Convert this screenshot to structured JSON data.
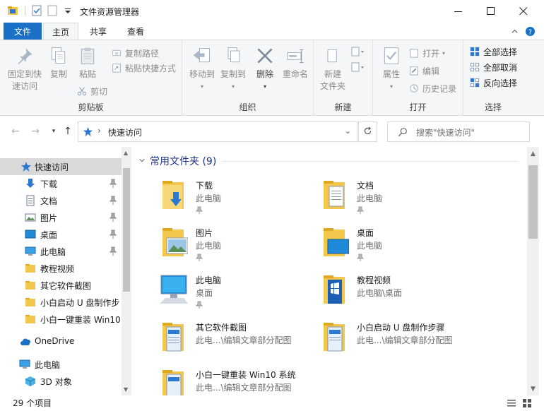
{
  "window": {
    "title": "文件资源管理器"
  },
  "tabs": {
    "file": "文件",
    "items": [
      "主页",
      "共享",
      "查看"
    ]
  },
  "ribbon": {
    "clipboard": {
      "pin_label_1": "固定到快",
      "pin_label_2": "速访问",
      "copy": "复制",
      "paste": "粘贴",
      "copy_path": "复制路径",
      "paste_shortcut": "粘贴快捷方式",
      "cut": "剪切",
      "group_label": "剪贴板"
    },
    "organize": {
      "move_to": "移动到",
      "copy_to": "复制到",
      "delete": "删除",
      "rename": "重命名",
      "group_label": "组织"
    },
    "new": {
      "new_folder_1": "新建",
      "new_folder_2": "文件夹",
      "group_label": "新建"
    },
    "open": {
      "properties": "属性",
      "open": "打开",
      "edit": "编辑",
      "history": "历史记录",
      "group_label": "打开"
    },
    "select": {
      "select_all": "全部选择",
      "select_none": "全部取消",
      "invert": "反向选择",
      "group_label": "选择"
    }
  },
  "address": {
    "path": "快速访问",
    "search_placeholder": "搜索\"快速访问\""
  },
  "nav": {
    "items": [
      {
        "label": "快速访问",
        "icon": "quick-access-star-icon",
        "pinned": false
      },
      {
        "label": "下载",
        "icon": "download-arrow-icon",
        "pinned": true
      },
      {
        "label": "文档",
        "icon": "document-icon",
        "pinned": true
      },
      {
        "label": "图片",
        "icon": "picture-icon",
        "pinned": true
      },
      {
        "label": "桌面",
        "icon": "desktop-icon",
        "pinned": true
      },
      {
        "label": "此电脑",
        "icon": "computer-icon",
        "pinned": true
      },
      {
        "label": "教程视频",
        "icon": "folder-icon",
        "pinned": false
      },
      {
        "label": "其它软件截图",
        "icon": "folder-icon",
        "pinned": false
      },
      {
        "label": "小白启动 U 盘制作步",
        "icon": "folder-icon",
        "pinned": false
      },
      {
        "label": "小白一键重装 Win10",
        "icon": "folder-icon",
        "pinned": false
      },
      {
        "label": "OneDrive",
        "icon": "cloud-icon",
        "pinned": false
      },
      {
        "label": "此电脑",
        "icon": "computer-icon",
        "pinned": false
      },
      {
        "label": "3D 对象",
        "icon": "cube-3d-icon",
        "pinned": false
      }
    ]
  },
  "content": {
    "group_title": "常用文件夹 (9)",
    "tiles": [
      {
        "name": "下载",
        "sub": "此电脑",
        "pinned": true
      },
      {
        "name": "文档",
        "sub": "此电脑",
        "pinned": true
      },
      {
        "name": "图片",
        "sub": "此电脑",
        "pinned": true
      },
      {
        "name": "桌面",
        "sub": "此电脑",
        "pinned": true
      },
      {
        "name": "此电脑",
        "sub": "桌面",
        "pinned": true
      },
      {
        "name": "教程视频",
        "sub": "此电脑\\桌面",
        "pinned": false
      },
      {
        "name": "其它软件截图",
        "sub": "此电...\\编辑文章部分配图",
        "pinned": false
      },
      {
        "name": "小白启动 U 盘制作步骤",
        "sub": "此电...\\编辑文章部分配图",
        "pinned": false
      },
      {
        "name": "小白一键重装 Win10 系统",
        "sub": "此电...\\编辑文章部分配图",
        "pinned": false
      }
    ]
  },
  "status": {
    "count": "29 个项目"
  },
  "colors": {
    "accent": "#1a6fc7",
    "folder": "#f3c74c",
    "group_title": "#1e3287"
  }
}
